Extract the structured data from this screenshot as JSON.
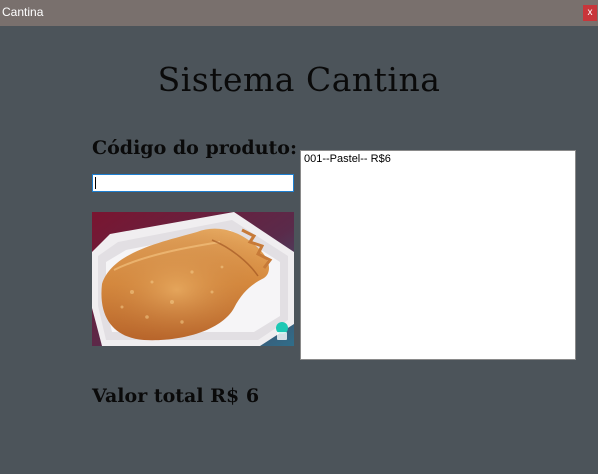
{
  "window": {
    "title": "Cantina",
    "close_label": "x"
  },
  "main": {
    "heading": "Sistema Cantina",
    "code_label": "Código do produto:",
    "code_input_value": "",
    "product_image_icon": "pastel-photo",
    "list_items": [
      "001--Pastel-- R$6"
    ],
    "total_label": "Valor total R$",
    "total_value": "6"
  },
  "colors": {
    "background": "#4c545a",
    "titlebar": "#79706d",
    "close_button": "#c8353a",
    "input_focus_border": "#1e7fd0"
  }
}
